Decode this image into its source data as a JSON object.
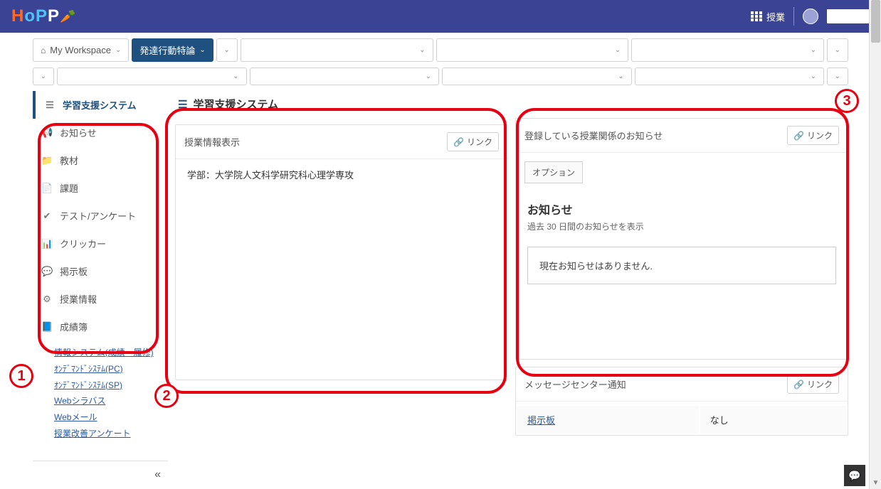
{
  "header": {
    "classes_label": "授業"
  },
  "tabs": {
    "workspace": "My Workspace",
    "active": "発達行動特論"
  },
  "sidebar": {
    "system": "学習支援システム",
    "items": [
      {
        "label": "お知らせ"
      },
      {
        "label": "教材"
      },
      {
        "label": "課題"
      },
      {
        "label": "テスト/アンケート"
      },
      {
        "label": "クリッカー"
      },
      {
        "label": "掲示板"
      },
      {
        "label": "授業情報"
      },
      {
        "label": "成績簿"
      }
    ],
    "links": [
      "情報システム(成績・履修)",
      "ｵﾝﾃﾞﾏﾝﾄﾞｼｽﾃﾑ(PC)",
      "ｵﾝﾃﾞﾏﾝﾄﾞｼｽﾃﾑ(SP)",
      "Webシラバス",
      "Webメール",
      "授業改善アンケート"
    ]
  },
  "main_heading": "学習支援システム",
  "panel1": {
    "title": "授業情報表示",
    "link": "リンク",
    "body": "学部：大学院人文科学研究科心理学専攻"
  },
  "panel2": {
    "title": "登録している授業関係のお知らせ",
    "link": "リンク",
    "options": "オプション",
    "heading": "お知らせ",
    "sub": "過去 30 日間のお知らせを表示",
    "empty": "現在お知らせはありません."
  },
  "panel3": {
    "title": "メッセージセンター通知",
    "link": "リンク",
    "row_label": "掲示板",
    "row_value": "なし"
  },
  "annotations": {
    "n1": "1",
    "n2": "2",
    "n3": "3"
  }
}
